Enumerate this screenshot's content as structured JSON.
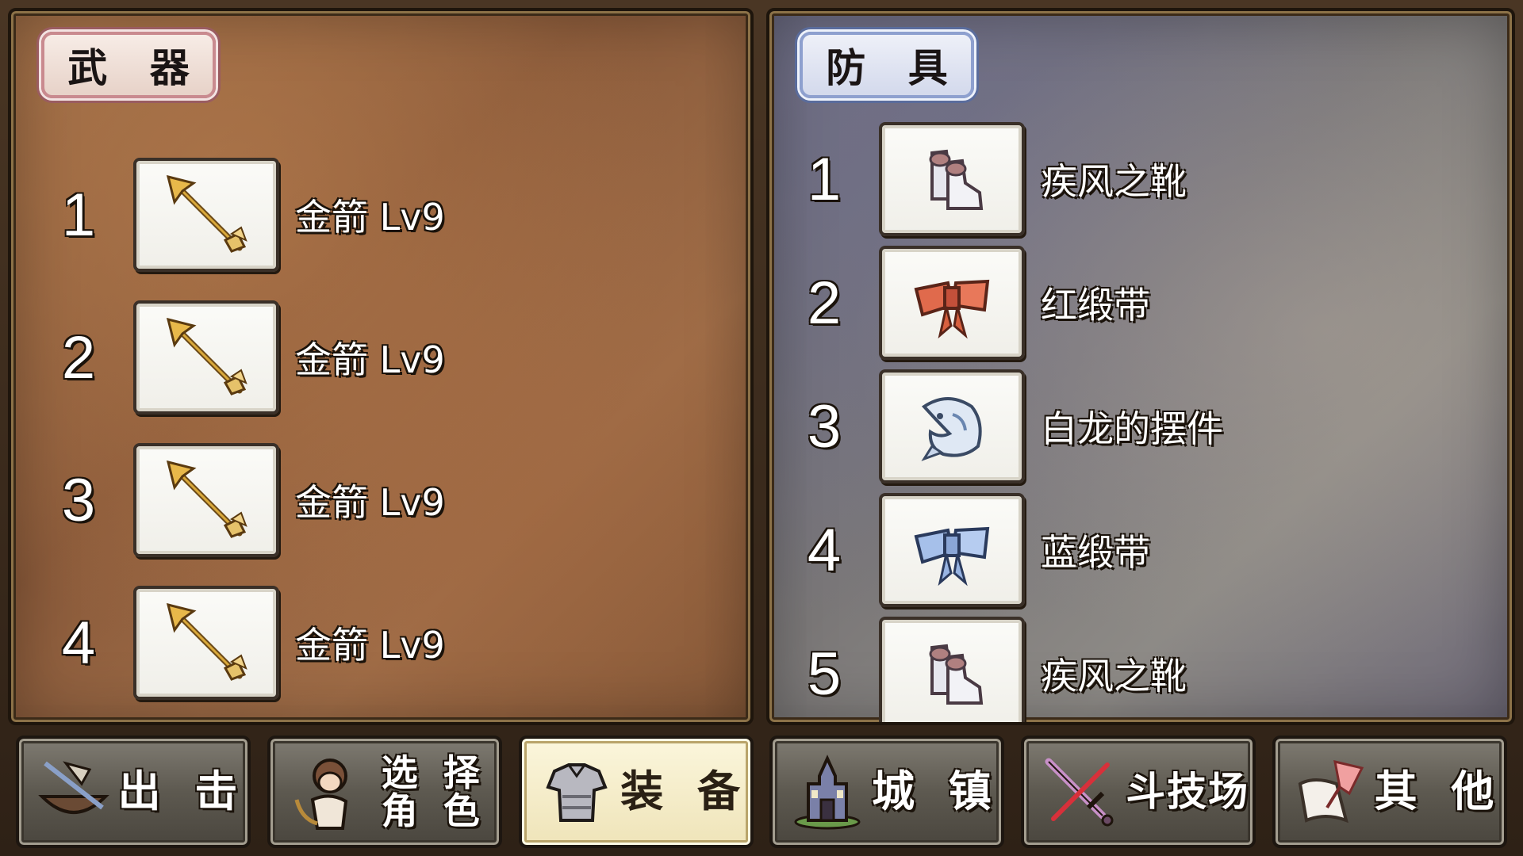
{
  "weapons_panel": {
    "title": "武 器",
    "items": [
      {
        "num": "1",
        "name": "金箭 Lv9",
        "icon": "golden-arrow-icon"
      },
      {
        "num": "2",
        "name": "金箭 Lv9",
        "icon": "golden-arrow-icon"
      },
      {
        "num": "3",
        "name": "金箭 Lv9",
        "icon": "golden-arrow-icon"
      },
      {
        "num": "4",
        "name": "金箭 Lv9",
        "icon": "golden-arrow-icon"
      }
    ]
  },
  "armor_panel": {
    "title": "防 具",
    "items": [
      {
        "num": "1",
        "name": "疾风之靴",
        "icon": "boots-icon"
      },
      {
        "num": "2",
        "name": "红缎带",
        "icon": "red-ribbon-icon"
      },
      {
        "num": "3",
        "name": "白龙的摆件",
        "icon": "white-dragon-icon"
      },
      {
        "num": "4",
        "name": "蓝缎带",
        "icon": "blue-ribbon-icon"
      },
      {
        "num": "5",
        "name": "疾风之靴",
        "icon": "boots-icon"
      }
    ]
  },
  "nav": {
    "sortie": "出 击",
    "select_line1": "选 择",
    "select_line2": "角 色",
    "equip": "装 备",
    "town": "城 镇",
    "arena": "斗技场",
    "other": "其 他",
    "active": "equip"
  },
  "colors": {
    "weapons_panel": "#9a6a45",
    "armor_panel": "#7b7878",
    "nav_active": "#fbf6dc"
  }
}
